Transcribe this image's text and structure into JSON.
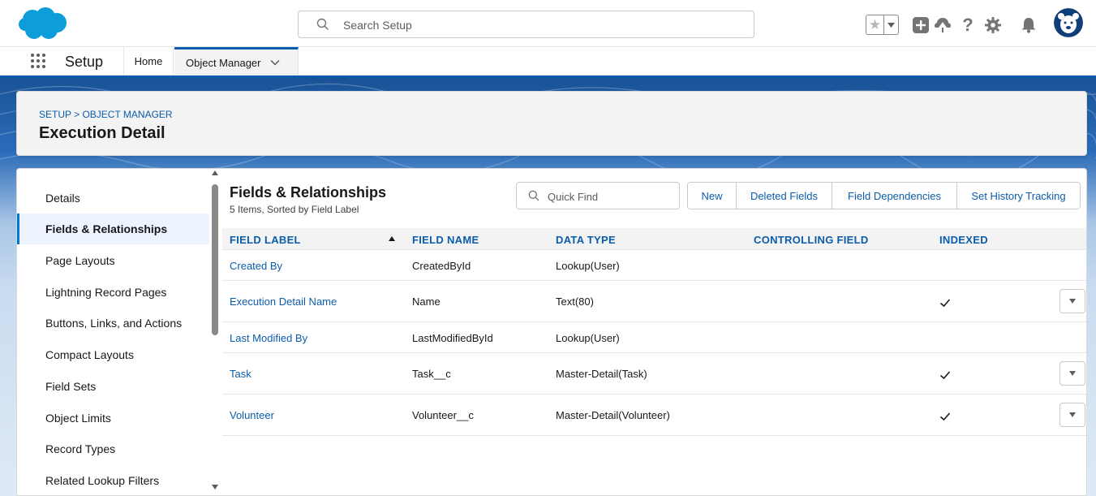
{
  "header": {
    "search_placeholder": "Search Setup",
    "icons": [
      "favorites-star-icon",
      "favorites-dropdown-icon",
      "global-actions-icon",
      "trailhead-guidance-icon",
      "help-icon",
      "setup-gear-icon",
      "notifications-bell-icon",
      "user-avatar"
    ]
  },
  "context_bar": {
    "app_name": "Setup",
    "tabs": [
      {
        "label": "Home"
      },
      {
        "label": "Object Manager"
      }
    ]
  },
  "page_header": {
    "breadcrumb": "SETUP > OBJECT MANAGER",
    "title": "Execution Detail"
  },
  "sidebar": {
    "items": [
      {
        "label": "Details"
      },
      {
        "label": "Fields & Relationships"
      },
      {
        "label": "Page Layouts"
      },
      {
        "label": "Lightning Record Pages"
      },
      {
        "label": "Buttons, Links, and Actions"
      },
      {
        "label": "Compact Layouts"
      },
      {
        "label": "Field Sets"
      },
      {
        "label": "Object Limits"
      },
      {
        "label": "Record Types"
      },
      {
        "label": "Related Lookup Filters"
      }
    ],
    "active_index": 1
  },
  "section": {
    "title": "Fields & Relationships",
    "subtitle": "5 Items, Sorted by Field Label",
    "quick_find_placeholder": "Quick Find",
    "buttons": [
      "New",
      "Deleted Fields",
      "Field Dependencies",
      "Set History Tracking"
    ]
  },
  "table": {
    "columns": [
      "FIELD LABEL",
      "FIELD NAME",
      "DATA TYPE",
      "CONTROLLING FIELD",
      "INDEXED"
    ],
    "rows": [
      {
        "label": "Created By",
        "name": "CreatedById",
        "type": "Lookup(User)",
        "controlling": "",
        "indexed": false,
        "menu": false
      },
      {
        "label": "Execution Detail Name",
        "name": "Name",
        "type": "Text(80)",
        "controlling": "",
        "indexed": true,
        "menu": true
      },
      {
        "label": "Last Modified By",
        "name": "LastModifiedById",
        "type": "Lookup(User)",
        "controlling": "",
        "indexed": false,
        "menu": false
      },
      {
        "label": "Task",
        "name": "Task__c",
        "type": "Master-Detail(Task)",
        "controlling": "",
        "indexed": true,
        "menu": true
      },
      {
        "label": "Volunteer",
        "name": "Volunteer__c",
        "type": "Master-Detail(Volunteer)",
        "controlling": "",
        "indexed": true,
        "menu": true
      }
    ]
  },
  "colors": {
    "brand_blue": "#0b5cab",
    "logo_blue": "#0d9dda",
    "active_nav": "#0176d3"
  }
}
